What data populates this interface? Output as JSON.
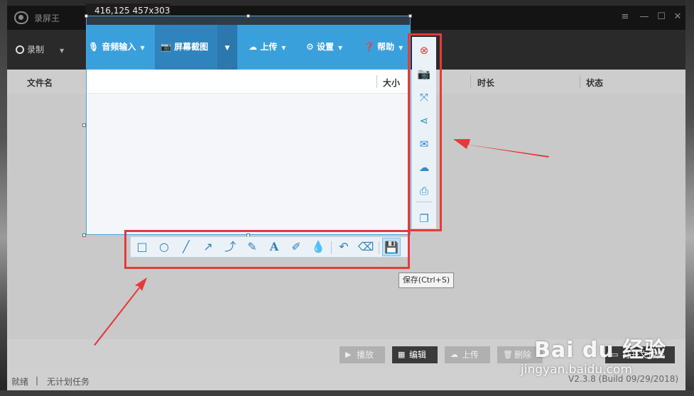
{
  "window": {
    "title": "录屏王",
    "controls": [
      "≡",
      "—",
      "☐",
      "✕"
    ]
  },
  "menubar": {
    "record": "录制",
    "audio_input": "音频输入",
    "screenshot": "屏幕截图",
    "upload": "上传",
    "settings": "设置",
    "help": "帮助"
  },
  "columns": {
    "filename": "文件名",
    "size": "大小",
    "duration": "时长",
    "status": "状态"
  },
  "actions": {
    "play": "播放",
    "edit": "编辑",
    "upload": "上传",
    "delete": "删除",
    "open_folder": "打开文件夹"
  },
  "status": {
    "ready": "就绪",
    "separator": "|",
    "no_task": "无计划任务",
    "version": "V2.3.8 (Build 09/29/2018)"
  },
  "capture": {
    "info": "416,125 457x303",
    "tooltip": "保存(Ctrl+S)"
  },
  "watermark": {
    "logo": "Bai du 经验",
    "url": "jingyan.baidu.com"
  },
  "colors": {
    "accent_blue": "#3aa0dc",
    "highlight_red": "#e53a3a",
    "close_red": "#e0403a"
  },
  "icons": {
    "side_tools": [
      "close-circle-icon",
      "camera-icon",
      "fullscreen-icon",
      "share-icon",
      "mail-icon",
      "cloud-upload-icon",
      "print-icon",
      "copy-icon"
    ],
    "draw_tools": [
      "rectangle-icon",
      "ellipse-icon",
      "line-icon",
      "arrow-icon",
      "curved-arrow-icon",
      "brush-icon",
      "text-icon",
      "highlighter-icon",
      "blur-drop-icon",
      "undo-icon",
      "eraser-icon",
      "save-icon"
    ]
  }
}
